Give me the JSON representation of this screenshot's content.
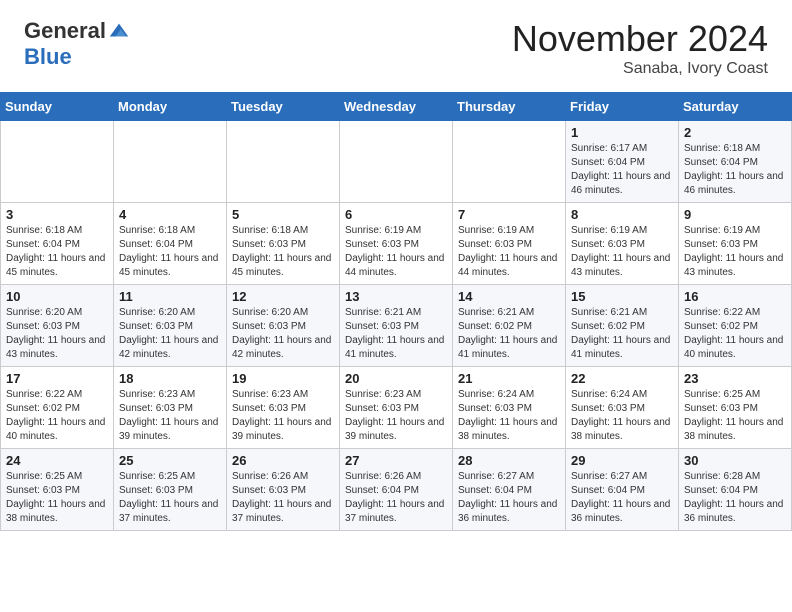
{
  "header": {
    "logo_general": "General",
    "logo_blue": "Blue",
    "month_title": "November 2024",
    "location": "Sanaba, Ivory Coast"
  },
  "calendar": {
    "days_of_week": [
      "Sunday",
      "Monday",
      "Tuesday",
      "Wednesday",
      "Thursday",
      "Friday",
      "Saturday"
    ],
    "weeks": [
      [
        {
          "day": "",
          "info": ""
        },
        {
          "day": "",
          "info": ""
        },
        {
          "day": "",
          "info": ""
        },
        {
          "day": "",
          "info": ""
        },
        {
          "day": "",
          "info": ""
        },
        {
          "day": "1",
          "info": "Sunrise: 6:17 AM\nSunset: 6:04 PM\nDaylight: 11 hours and 46 minutes."
        },
        {
          "day": "2",
          "info": "Sunrise: 6:18 AM\nSunset: 6:04 PM\nDaylight: 11 hours and 46 minutes."
        }
      ],
      [
        {
          "day": "3",
          "info": "Sunrise: 6:18 AM\nSunset: 6:04 PM\nDaylight: 11 hours and 45 minutes."
        },
        {
          "day": "4",
          "info": "Sunrise: 6:18 AM\nSunset: 6:04 PM\nDaylight: 11 hours and 45 minutes."
        },
        {
          "day": "5",
          "info": "Sunrise: 6:18 AM\nSunset: 6:03 PM\nDaylight: 11 hours and 45 minutes."
        },
        {
          "day": "6",
          "info": "Sunrise: 6:19 AM\nSunset: 6:03 PM\nDaylight: 11 hours and 44 minutes."
        },
        {
          "day": "7",
          "info": "Sunrise: 6:19 AM\nSunset: 6:03 PM\nDaylight: 11 hours and 44 minutes."
        },
        {
          "day": "8",
          "info": "Sunrise: 6:19 AM\nSunset: 6:03 PM\nDaylight: 11 hours and 43 minutes."
        },
        {
          "day": "9",
          "info": "Sunrise: 6:19 AM\nSunset: 6:03 PM\nDaylight: 11 hours and 43 minutes."
        }
      ],
      [
        {
          "day": "10",
          "info": "Sunrise: 6:20 AM\nSunset: 6:03 PM\nDaylight: 11 hours and 43 minutes."
        },
        {
          "day": "11",
          "info": "Sunrise: 6:20 AM\nSunset: 6:03 PM\nDaylight: 11 hours and 42 minutes."
        },
        {
          "day": "12",
          "info": "Sunrise: 6:20 AM\nSunset: 6:03 PM\nDaylight: 11 hours and 42 minutes."
        },
        {
          "day": "13",
          "info": "Sunrise: 6:21 AM\nSunset: 6:03 PM\nDaylight: 11 hours and 41 minutes."
        },
        {
          "day": "14",
          "info": "Sunrise: 6:21 AM\nSunset: 6:02 PM\nDaylight: 11 hours and 41 minutes."
        },
        {
          "day": "15",
          "info": "Sunrise: 6:21 AM\nSunset: 6:02 PM\nDaylight: 11 hours and 41 minutes."
        },
        {
          "day": "16",
          "info": "Sunrise: 6:22 AM\nSunset: 6:02 PM\nDaylight: 11 hours and 40 minutes."
        }
      ],
      [
        {
          "day": "17",
          "info": "Sunrise: 6:22 AM\nSunset: 6:02 PM\nDaylight: 11 hours and 40 minutes."
        },
        {
          "day": "18",
          "info": "Sunrise: 6:23 AM\nSunset: 6:03 PM\nDaylight: 11 hours and 39 minutes."
        },
        {
          "day": "19",
          "info": "Sunrise: 6:23 AM\nSunset: 6:03 PM\nDaylight: 11 hours and 39 minutes."
        },
        {
          "day": "20",
          "info": "Sunrise: 6:23 AM\nSunset: 6:03 PM\nDaylight: 11 hours and 39 minutes."
        },
        {
          "day": "21",
          "info": "Sunrise: 6:24 AM\nSunset: 6:03 PM\nDaylight: 11 hours and 38 minutes."
        },
        {
          "day": "22",
          "info": "Sunrise: 6:24 AM\nSunset: 6:03 PM\nDaylight: 11 hours and 38 minutes."
        },
        {
          "day": "23",
          "info": "Sunrise: 6:25 AM\nSunset: 6:03 PM\nDaylight: 11 hours and 38 minutes."
        }
      ],
      [
        {
          "day": "24",
          "info": "Sunrise: 6:25 AM\nSunset: 6:03 PM\nDaylight: 11 hours and 38 minutes."
        },
        {
          "day": "25",
          "info": "Sunrise: 6:25 AM\nSunset: 6:03 PM\nDaylight: 11 hours and 37 minutes."
        },
        {
          "day": "26",
          "info": "Sunrise: 6:26 AM\nSunset: 6:03 PM\nDaylight: 11 hours and 37 minutes."
        },
        {
          "day": "27",
          "info": "Sunrise: 6:26 AM\nSunset: 6:04 PM\nDaylight: 11 hours and 37 minutes."
        },
        {
          "day": "28",
          "info": "Sunrise: 6:27 AM\nSunset: 6:04 PM\nDaylight: 11 hours and 36 minutes."
        },
        {
          "day": "29",
          "info": "Sunrise: 6:27 AM\nSunset: 6:04 PM\nDaylight: 11 hours and 36 minutes."
        },
        {
          "day": "30",
          "info": "Sunrise: 6:28 AM\nSunset: 6:04 PM\nDaylight: 11 hours and 36 minutes."
        }
      ]
    ]
  }
}
